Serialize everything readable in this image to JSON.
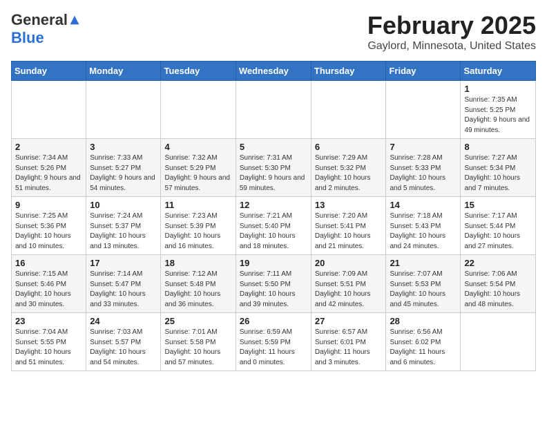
{
  "logo": {
    "general": "General",
    "blue": "Blue"
  },
  "title": "February 2025",
  "location": "Gaylord, Minnesota, United States",
  "days_of_week": [
    "Sunday",
    "Monday",
    "Tuesday",
    "Wednesday",
    "Thursday",
    "Friday",
    "Saturday"
  ],
  "weeks": [
    [
      {
        "day": "",
        "info": ""
      },
      {
        "day": "",
        "info": ""
      },
      {
        "day": "",
        "info": ""
      },
      {
        "day": "",
        "info": ""
      },
      {
        "day": "",
        "info": ""
      },
      {
        "day": "",
        "info": ""
      },
      {
        "day": "1",
        "info": "Sunrise: 7:35 AM\nSunset: 5:25 PM\nDaylight: 9 hours and 49 minutes."
      }
    ],
    [
      {
        "day": "2",
        "info": "Sunrise: 7:34 AM\nSunset: 5:26 PM\nDaylight: 9 hours and 51 minutes."
      },
      {
        "day": "3",
        "info": "Sunrise: 7:33 AM\nSunset: 5:27 PM\nDaylight: 9 hours and 54 minutes."
      },
      {
        "day": "4",
        "info": "Sunrise: 7:32 AM\nSunset: 5:29 PM\nDaylight: 9 hours and 57 minutes."
      },
      {
        "day": "5",
        "info": "Sunrise: 7:31 AM\nSunset: 5:30 PM\nDaylight: 9 hours and 59 minutes."
      },
      {
        "day": "6",
        "info": "Sunrise: 7:29 AM\nSunset: 5:32 PM\nDaylight: 10 hours and 2 minutes."
      },
      {
        "day": "7",
        "info": "Sunrise: 7:28 AM\nSunset: 5:33 PM\nDaylight: 10 hours and 5 minutes."
      },
      {
        "day": "8",
        "info": "Sunrise: 7:27 AM\nSunset: 5:34 PM\nDaylight: 10 hours and 7 minutes."
      }
    ],
    [
      {
        "day": "9",
        "info": "Sunrise: 7:25 AM\nSunset: 5:36 PM\nDaylight: 10 hours and 10 minutes."
      },
      {
        "day": "10",
        "info": "Sunrise: 7:24 AM\nSunset: 5:37 PM\nDaylight: 10 hours and 13 minutes."
      },
      {
        "day": "11",
        "info": "Sunrise: 7:23 AM\nSunset: 5:39 PM\nDaylight: 10 hours and 16 minutes."
      },
      {
        "day": "12",
        "info": "Sunrise: 7:21 AM\nSunset: 5:40 PM\nDaylight: 10 hours and 18 minutes."
      },
      {
        "day": "13",
        "info": "Sunrise: 7:20 AM\nSunset: 5:41 PM\nDaylight: 10 hours and 21 minutes."
      },
      {
        "day": "14",
        "info": "Sunrise: 7:18 AM\nSunset: 5:43 PM\nDaylight: 10 hours and 24 minutes."
      },
      {
        "day": "15",
        "info": "Sunrise: 7:17 AM\nSunset: 5:44 PM\nDaylight: 10 hours and 27 minutes."
      }
    ],
    [
      {
        "day": "16",
        "info": "Sunrise: 7:15 AM\nSunset: 5:46 PM\nDaylight: 10 hours and 30 minutes."
      },
      {
        "day": "17",
        "info": "Sunrise: 7:14 AM\nSunset: 5:47 PM\nDaylight: 10 hours and 33 minutes."
      },
      {
        "day": "18",
        "info": "Sunrise: 7:12 AM\nSunset: 5:48 PM\nDaylight: 10 hours and 36 minutes."
      },
      {
        "day": "19",
        "info": "Sunrise: 7:11 AM\nSunset: 5:50 PM\nDaylight: 10 hours and 39 minutes."
      },
      {
        "day": "20",
        "info": "Sunrise: 7:09 AM\nSunset: 5:51 PM\nDaylight: 10 hours and 42 minutes."
      },
      {
        "day": "21",
        "info": "Sunrise: 7:07 AM\nSunset: 5:53 PM\nDaylight: 10 hours and 45 minutes."
      },
      {
        "day": "22",
        "info": "Sunrise: 7:06 AM\nSunset: 5:54 PM\nDaylight: 10 hours and 48 minutes."
      }
    ],
    [
      {
        "day": "23",
        "info": "Sunrise: 7:04 AM\nSunset: 5:55 PM\nDaylight: 10 hours and 51 minutes."
      },
      {
        "day": "24",
        "info": "Sunrise: 7:03 AM\nSunset: 5:57 PM\nDaylight: 10 hours and 54 minutes."
      },
      {
        "day": "25",
        "info": "Sunrise: 7:01 AM\nSunset: 5:58 PM\nDaylight: 10 hours and 57 minutes."
      },
      {
        "day": "26",
        "info": "Sunrise: 6:59 AM\nSunset: 5:59 PM\nDaylight: 11 hours and 0 minutes."
      },
      {
        "day": "27",
        "info": "Sunrise: 6:57 AM\nSunset: 6:01 PM\nDaylight: 11 hours and 3 minutes."
      },
      {
        "day": "28",
        "info": "Sunrise: 6:56 AM\nSunset: 6:02 PM\nDaylight: 11 hours and 6 minutes."
      },
      {
        "day": "",
        "info": ""
      }
    ]
  ]
}
